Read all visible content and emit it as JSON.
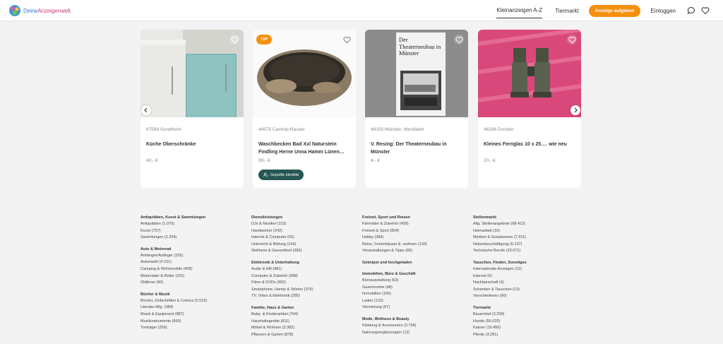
{
  "header": {
    "logo_left": "Deine",
    "logo_right": "Anzeigenwelt",
    "nav": [
      "Kleinanzeigen A-Z",
      "Tiermarkt"
    ],
    "cta": "Anzeige aufgeben",
    "login": "Einloggen",
    "icons": [
      "chat-icon",
      "heart-icon"
    ]
  },
  "listings": [
    {
      "location": "67599 Gundheim",
      "title": "Küche Oberschränke",
      "price": "40,- €",
      "badge": "",
      "verified": ""
    },
    {
      "location": "44575 Castrop-Rauxel",
      "title": "Waschbecken Bad Xxl Naturstein Findling Herne Unna Hamm Lünen…",
      "price": "99,- €",
      "badge": "TOP",
      "verified": "Geprüfte Identität"
    },
    {
      "location": "48155 Münster, Westfalen",
      "title": "V. Resing: Der Theaterneubau in Münster",
      "price": "4,- €",
      "badge": "",
      "verified": "",
      "cover_text": "Der Theaterneubau in Münster"
    },
    {
      "location": "46286 Dorsten",
      "title": "Kleines Fernglas 10 x 25…. wie neu",
      "price": "20,- €",
      "badge": "",
      "verified": ""
    }
  ],
  "categories": [
    [
      {
        "h": "Antiquitäten, Kunst & Sammlungen",
        "items": [
          "Antiquitäten (1.070)",
          "Kunst (757)",
          "Sammlungen (2.254)"
        ]
      },
      {
        "h": "Auto & Motorrad",
        "items": [
          "Anhänger/Aufleger (155)",
          "Automarkt (4.151)",
          "Camping & Wohnmobile (405)",
          "Motorräder & Roller (115)",
          "Oldtimer (90)"
        ]
      },
      {
        "h": "Bücher & Musik",
        "items": [
          "Bücher, Zeitschriften & Comics (5.519)",
          "Literatur Allg. (384)",
          "Musik & Equipment (887)",
          "Musikinstrumente (660)",
          "Tonträger (250)"
        ]
      }
    ],
    [
      {
        "h": "Dienstleistungen",
        "items": [
          "DJs & Musiker (113)",
          "Handwerker (242)",
          "Internet & Computer (55)",
          "Unterricht & Bildung (164)",
          "Wellness & Gesundheit (383)"
        ]
      },
      {
        "h": "Elektronik & Unterhaltung",
        "items": [
          "Audio & Hifi (481)",
          "Computer & Zubehör (688)",
          "Filme & DVDs (802)",
          "Smartphone, Handy & Telefon (376)",
          "TV, Video & Elektronik (285)"
        ]
      },
      {
        "h": "Familie, Haus & Garten",
        "items": [
          "Baby- & Kinderartikel (764)",
          "Haushaltsgeräte (811)",
          "Möbel & Wohnen (3.382)",
          "Pflanzen & Garten (878)"
        ]
      }
    ],
    [
      {
        "h": "Freizeit, Sport und Reisen",
        "items": [
          "Fahrräder & Zubehör (439)",
          "Freizeit & Sport (804)",
          "Hobby (384)",
          "Reise, Ferienhäuser & -wohnen (139)",
          "Veranstaltungen & Tipps (83)"
        ]
      },
      {
        "h": "Geknipst und hochgeladen",
        "items": []
      },
      {
        "h": "Immobilien, Büro & Geschäft",
        "items": [
          "Büroausstattung (63)",
          "Gastronomie (48)",
          "Immobilien (156)",
          "Laden (123)",
          "Vermietung (97)"
        ]
      },
      {
        "h": "Mode, Wellness & Beauty",
        "items": [
          "Kleidung & Accessoires (3.794)",
          "Nahrungsergänzungen (12)"
        ]
      }
    ],
    [
      {
        "h": "Stellenmarkt",
        "items": [
          "Allg. Stellenangebote (68.413)",
          "Heimarbeit (16)",
          "Medizin & Sozialwesen (7.911)",
          "Nebenbeschäftigung (6.137)",
          "Technische Berufe (23.671)"
        ]
      },
      {
        "h": "Tauschen, Finden, Sonstiges",
        "items": [
          "Internationale Anzeigen (12)",
          "Internet (6)",
          "Nachbarschaft (4)",
          "Schenken & Tauschen (13)",
          "Verschiedenes (90)"
        ]
      },
      {
        "h": "Tiermarkt",
        "items": [
          "Bauernhof (3.239)",
          "Hunde (55.020)",
          "Katzen (19.450)",
          "Pferde (3.281)"
        ]
      }
    ]
  ]
}
